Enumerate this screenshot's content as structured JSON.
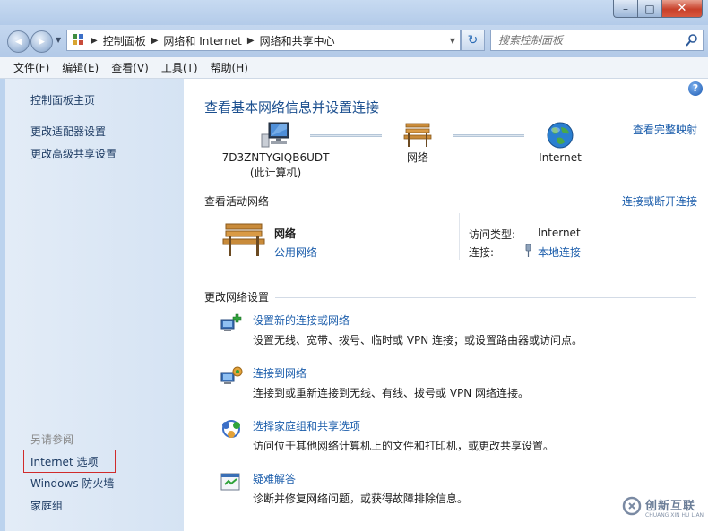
{
  "window": {
    "min_symbol": "–",
    "max_symbol": "□",
    "close_symbol": "✕"
  },
  "nav": {
    "back": "◀",
    "forward": "▶",
    "history": "▼",
    "refresh": "↻",
    "addr_drop": "▼",
    "sep": "▶"
  },
  "breadcrumb": [
    "控制面板",
    "网络和 Internet",
    "网络和共享中心"
  ],
  "search": {
    "placeholder": "搜索控制面板"
  },
  "menu": [
    "文件(F)",
    "编辑(E)",
    "查看(V)",
    "工具(T)",
    "帮助(H)"
  ],
  "sidebar": {
    "items": [
      "控制面板主页",
      "更改适配器设置",
      "更改高级共享设置"
    ],
    "see_also_label": "另请参阅",
    "see_also": [
      "Internet 选项",
      "Windows 防火墙",
      "家庭组"
    ]
  },
  "main": {
    "help": "?",
    "title": "查看基本网络信息并设置连接",
    "full_map": "查看完整映射",
    "map": {
      "computer_name": "7D3ZNTYGIQB6UDT",
      "computer_sub": "(此计算机)",
      "network": "网络",
      "internet": "Internet"
    },
    "active": {
      "header": "查看活动网络",
      "connect_link": "连接或断开连接",
      "name": "网络",
      "type": "公用网络",
      "access_label": "访问类型:",
      "access_value": "Internet",
      "conn_label": "连接:",
      "conn_value": "本地连接"
    },
    "change": {
      "header": "更改网络设置",
      "tasks": [
        {
          "link": "设置新的连接或网络",
          "desc": "设置无线、宽带、拨号、临时或 VPN 连接；或设置路由器或访问点。"
        },
        {
          "link": "连接到网络",
          "desc": "连接到或重新连接到无线、有线、拨号或 VPN 网络连接。"
        },
        {
          "link": "选择家庭组和共享选项",
          "desc": "访问位于其他网络计算机上的文件和打印机，或更改共享设置。"
        },
        {
          "link": "疑难解答",
          "desc": "诊断并修复网络问题，或获得故障排除信息。"
        }
      ]
    }
  },
  "watermark": {
    "cn": "创新互联",
    "en": "CHUANG XIN HU LIAN"
  },
  "colors": {
    "link": "#1b5dab",
    "title": "#1b4f8f",
    "highlight_border": "#d02b2b"
  }
}
